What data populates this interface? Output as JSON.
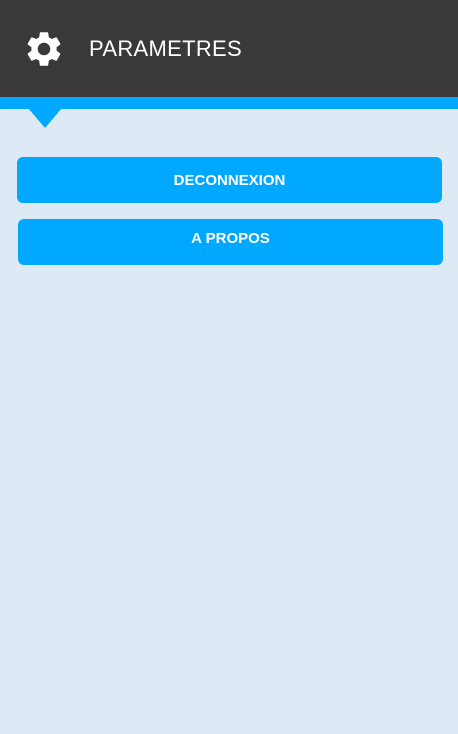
{
  "header": {
    "title": "PARAMETRES",
    "icon": "gear-icon"
  },
  "actions": {
    "logout_label": "DECONNEXION",
    "about_label": "A PROPOS"
  },
  "colors": {
    "header_bg": "#3a3937",
    "accent": "#00a8ff",
    "page_bg": "#dde9f5",
    "button_text": "#ffffff"
  }
}
